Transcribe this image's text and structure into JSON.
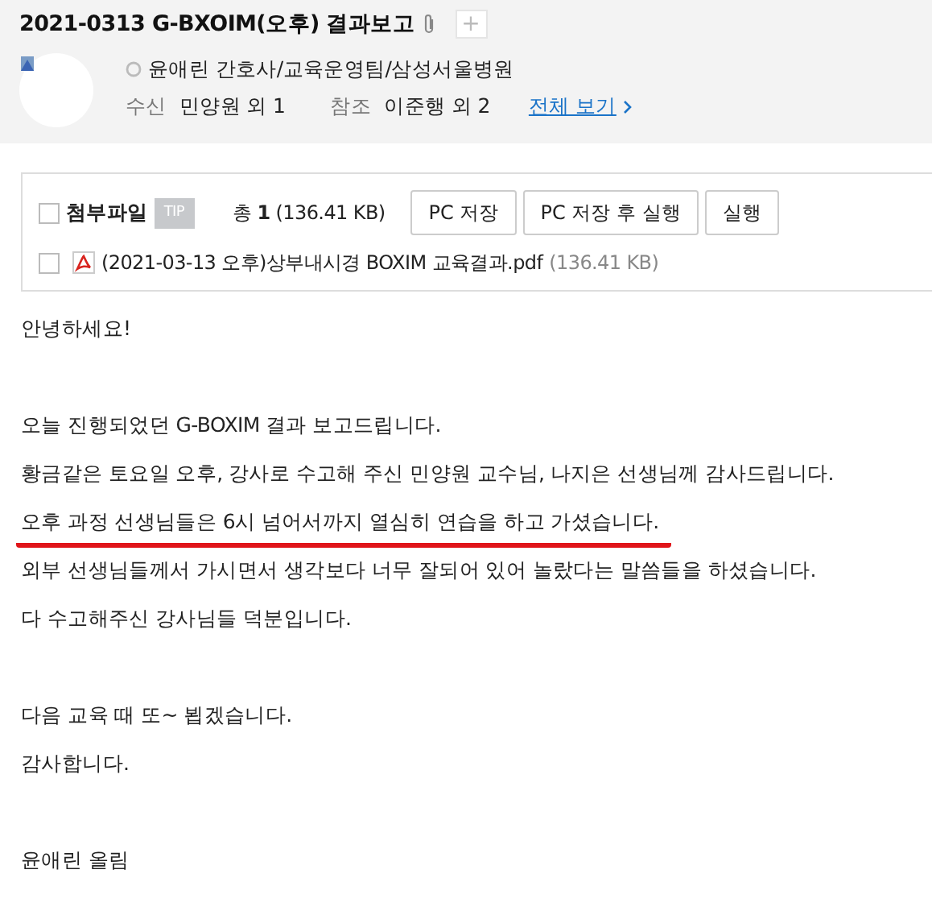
{
  "subject": "2021-0313 G-BXOIM(오후) 결과보고",
  "add_tag": "+",
  "sender": "윤애린 간호사/교육운영팀/삼성서울병원",
  "recipients": [
    {
      "label": "수신",
      "value": "민양원 외 1"
    },
    {
      "label": "참조",
      "value": "이준행 외 2"
    }
  ],
  "view_all": "전체 보기",
  "attachments": {
    "title": "첨부파일",
    "checked": false,
    "tip": "TIP",
    "total_prefix": "총",
    "total_count": "1",
    "total_size": "(136.41 KB)",
    "buttons": [
      "PC 저장",
      "PC 저장 후 실행",
      "실행"
    ],
    "files": [
      {
        "name": "(2021-03-13 오후)상부내시경 BOXIM 교육결과.pdf",
        "size": "(136.41 KB)",
        "checked": false
      }
    ]
  },
  "body": [
    {
      "lines": [
        {
          "text": "안녕하세요!",
          "underlined": false
        }
      ]
    },
    {
      "lines": [
        {
          "text": "오늘 진행되었던 G-BOXIM 결과 보고드립니다.",
          "underlined": false
        },
        {
          "text": "황금같은 토요일 오후, 강사로 수고해 주신 민양원 교수님, 나지은 선생님께 감사드립니다.",
          "underlined": false
        },
        {
          "text": "오후 과정 선생님들은 6시 넘어서까지 열심히 연습을 하고 가셨습니다.",
          "underlined": true
        },
        {
          "text": "외부 선생님들께서 가시면서 생각보다 너무 잘되어 있어 놀랐다는 말씀들을 하셨습니다.",
          "underlined": false
        },
        {
          "text": "다 수고해주신 강사님들 덕분입니다.",
          "underlined": false
        }
      ]
    },
    {
      "lines": [
        {
          "text": "다음 교육 때 또~ 뵙겠습니다.",
          "underlined": false
        },
        {
          "text": "감사합니다.",
          "underlined": false
        }
      ]
    },
    {
      "lines": [
        {
          "text": "윤애린 올림",
          "underlined": false
        }
      ]
    }
  ]
}
